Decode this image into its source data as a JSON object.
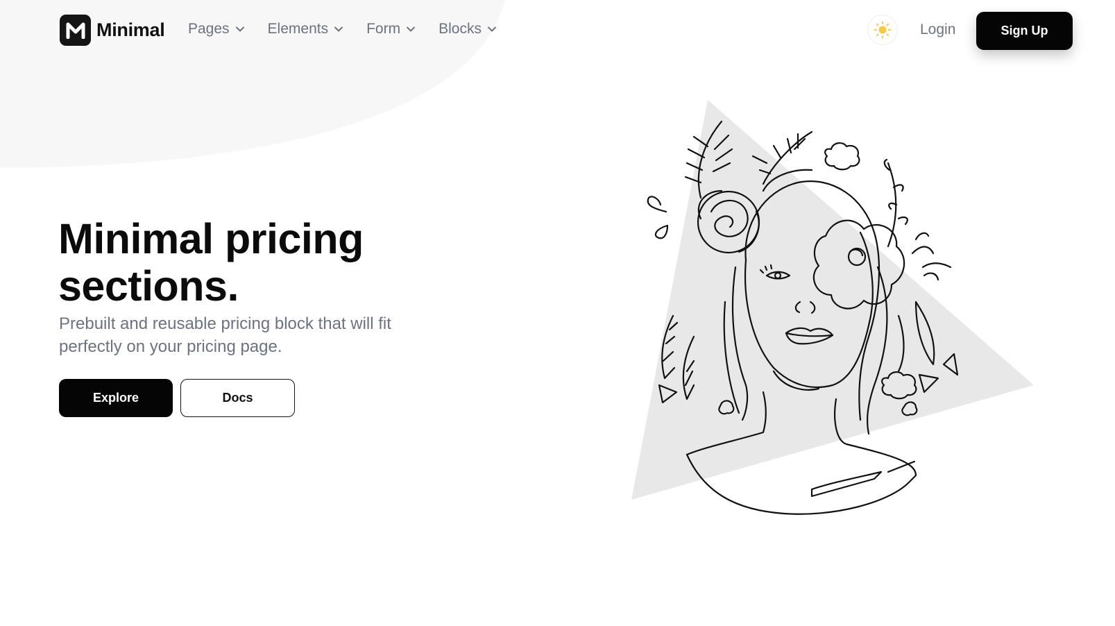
{
  "brand": {
    "name": "Minimal",
    "logo_letter": "M"
  },
  "nav": {
    "items": [
      {
        "label": "Pages",
        "icon": "chevron-down-icon"
      },
      {
        "label": "Elements",
        "icon": "chevron-down-icon"
      },
      {
        "label": "Form",
        "icon": "chevron-down-icon"
      },
      {
        "label": "Blocks",
        "icon": "chevron-down-icon"
      }
    ]
  },
  "header_actions": {
    "theme_icon": "sun-icon",
    "login_label": "Login",
    "signup_label": "Sign Up"
  },
  "hero": {
    "title": "Minimal pricing sections.",
    "subtitle": "Prebuilt and reusable pricing block that will fit perfectly on your pricing page.",
    "primary_button": "Explore",
    "secondary_button": "Docs"
  },
  "colors": {
    "primary": "#050505",
    "muted_text": "#6b7280",
    "background_shape": "#f7f7f7",
    "illustration_triangle": "#e8e8e8",
    "sun": "#f7c948"
  }
}
